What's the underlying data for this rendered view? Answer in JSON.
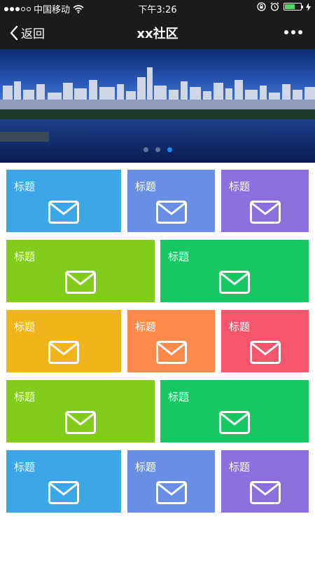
{
  "status": {
    "carrier": "中国移动",
    "time": "下午3:26"
  },
  "nav": {
    "back_label": "返回",
    "title": "xx社区"
  },
  "banner": {
    "slides": 3,
    "active_slide": 3
  },
  "tiles": [
    {
      "title": "标题",
      "color": "#3ca6e6",
      "icon": "mail-icon"
    },
    {
      "title": "标题",
      "color": "#6a8ee3",
      "icon": "mail-icon"
    },
    {
      "title": "标题",
      "color": "#8b6fdc",
      "icon": "mail-icon"
    },
    {
      "title": "标题",
      "color": "#84cc1c",
      "icon": "mail-icon"
    },
    {
      "title": "标题",
      "color": "#17c764",
      "icon": "mail-icon"
    },
    {
      "title": "标题",
      "color": "#f2b41b",
      "icon": "mail-icon"
    },
    {
      "title": "标题",
      "color": "#ff8a4c",
      "icon": "mail-icon"
    },
    {
      "title": "标题",
      "color": "#f6566d",
      "icon": "mail-icon"
    },
    {
      "title": "标题",
      "color": "#84cc1c",
      "icon": "mail-icon"
    },
    {
      "title": "标题",
      "color": "#17c764",
      "icon": "mail-icon"
    },
    {
      "title": "标题",
      "color": "#3ca6e6",
      "icon": "mail-icon"
    },
    {
      "title": "标题",
      "color": "#6a8ee3",
      "icon": "mail-icon"
    },
    {
      "title": "标题",
      "color": "#8b6fdc",
      "icon": "mail-icon"
    }
  ]
}
